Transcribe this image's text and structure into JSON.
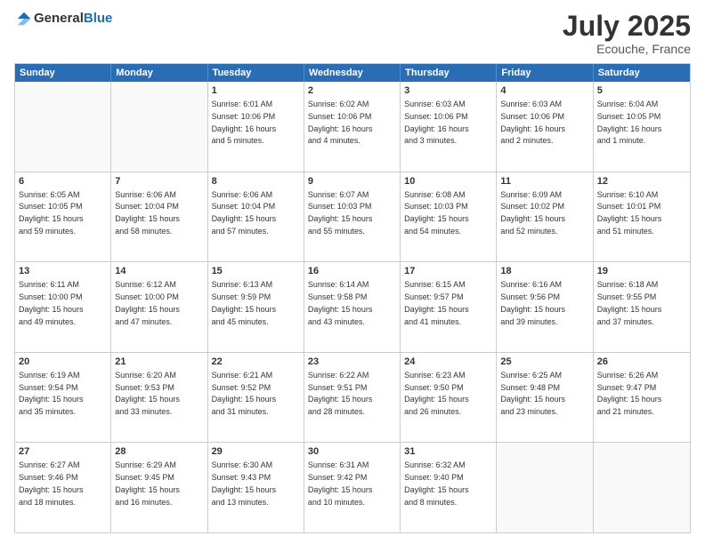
{
  "logo": {
    "general": "General",
    "blue": "Blue"
  },
  "title": "July 2025",
  "location": "Ecouche, France",
  "days": [
    "Sunday",
    "Monday",
    "Tuesday",
    "Wednesday",
    "Thursday",
    "Friday",
    "Saturday"
  ],
  "weeks": [
    [
      {
        "day": "",
        "info": ""
      },
      {
        "day": "",
        "info": ""
      },
      {
        "day": "1",
        "info": "Sunrise: 6:01 AM\nSunset: 10:06 PM\nDaylight: 16 hours\nand 5 minutes."
      },
      {
        "day": "2",
        "info": "Sunrise: 6:02 AM\nSunset: 10:06 PM\nDaylight: 16 hours\nand 4 minutes."
      },
      {
        "day": "3",
        "info": "Sunrise: 6:03 AM\nSunset: 10:06 PM\nDaylight: 16 hours\nand 3 minutes."
      },
      {
        "day": "4",
        "info": "Sunrise: 6:03 AM\nSunset: 10:06 PM\nDaylight: 16 hours\nand 2 minutes."
      },
      {
        "day": "5",
        "info": "Sunrise: 6:04 AM\nSunset: 10:05 PM\nDaylight: 16 hours\nand 1 minute."
      }
    ],
    [
      {
        "day": "6",
        "info": "Sunrise: 6:05 AM\nSunset: 10:05 PM\nDaylight: 15 hours\nand 59 minutes."
      },
      {
        "day": "7",
        "info": "Sunrise: 6:06 AM\nSunset: 10:04 PM\nDaylight: 15 hours\nand 58 minutes."
      },
      {
        "day": "8",
        "info": "Sunrise: 6:06 AM\nSunset: 10:04 PM\nDaylight: 15 hours\nand 57 minutes."
      },
      {
        "day": "9",
        "info": "Sunrise: 6:07 AM\nSunset: 10:03 PM\nDaylight: 15 hours\nand 55 minutes."
      },
      {
        "day": "10",
        "info": "Sunrise: 6:08 AM\nSunset: 10:03 PM\nDaylight: 15 hours\nand 54 minutes."
      },
      {
        "day": "11",
        "info": "Sunrise: 6:09 AM\nSunset: 10:02 PM\nDaylight: 15 hours\nand 52 minutes."
      },
      {
        "day": "12",
        "info": "Sunrise: 6:10 AM\nSunset: 10:01 PM\nDaylight: 15 hours\nand 51 minutes."
      }
    ],
    [
      {
        "day": "13",
        "info": "Sunrise: 6:11 AM\nSunset: 10:00 PM\nDaylight: 15 hours\nand 49 minutes."
      },
      {
        "day": "14",
        "info": "Sunrise: 6:12 AM\nSunset: 10:00 PM\nDaylight: 15 hours\nand 47 minutes."
      },
      {
        "day": "15",
        "info": "Sunrise: 6:13 AM\nSunset: 9:59 PM\nDaylight: 15 hours\nand 45 minutes."
      },
      {
        "day": "16",
        "info": "Sunrise: 6:14 AM\nSunset: 9:58 PM\nDaylight: 15 hours\nand 43 minutes."
      },
      {
        "day": "17",
        "info": "Sunrise: 6:15 AM\nSunset: 9:57 PM\nDaylight: 15 hours\nand 41 minutes."
      },
      {
        "day": "18",
        "info": "Sunrise: 6:16 AM\nSunset: 9:56 PM\nDaylight: 15 hours\nand 39 minutes."
      },
      {
        "day": "19",
        "info": "Sunrise: 6:18 AM\nSunset: 9:55 PM\nDaylight: 15 hours\nand 37 minutes."
      }
    ],
    [
      {
        "day": "20",
        "info": "Sunrise: 6:19 AM\nSunset: 9:54 PM\nDaylight: 15 hours\nand 35 minutes."
      },
      {
        "day": "21",
        "info": "Sunrise: 6:20 AM\nSunset: 9:53 PM\nDaylight: 15 hours\nand 33 minutes."
      },
      {
        "day": "22",
        "info": "Sunrise: 6:21 AM\nSunset: 9:52 PM\nDaylight: 15 hours\nand 31 minutes."
      },
      {
        "day": "23",
        "info": "Sunrise: 6:22 AM\nSunset: 9:51 PM\nDaylight: 15 hours\nand 28 minutes."
      },
      {
        "day": "24",
        "info": "Sunrise: 6:23 AM\nSunset: 9:50 PM\nDaylight: 15 hours\nand 26 minutes."
      },
      {
        "day": "25",
        "info": "Sunrise: 6:25 AM\nSunset: 9:48 PM\nDaylight: 15 hours\nand 23 minutes."
      },
      {
        "day": "26",
        "info": "Sunrise: 6:26 AM\nSunset: 9:47 PM\nDaylight: 15 hours\nand 21 minutes."
      }
    ],
    [
      {
        "day": "27",
        "info": "Sunrise: 6:27 AM\nSunset: 9:46 PM\nDaylight: 15 hours\nand 18 minutes."
      },
      {
        "day": "28",
        "info": "Sunrise: 6:29 AM\nSunset: 9:45 PM\nDaylight: 15 hours\nand 16 minutes."
      },
      {
        "day": "29",
        "info": "Sunrise: 6:30 AM\nSunset: 9:43 PM\nDaylight: 15 hours\nand 13 minutes."
      },
      {
        "day": "30",
        "info": "Sunrise: 6:31 AM\nSunset: 9:42 PM\nDaylight: 15 hours\nand 10 minutes."
      },
      {
        "day": "31",
        "info": "Sunrise: 6:32 AM\nSunset: 9:40 PM\nDaylight: 15 hours\nand 8 minutes."
      },
      {
        "day": "",
        "info": ""
      },
      {
        "day": "",
        "info": ""
      }
    ]
  ]
}
